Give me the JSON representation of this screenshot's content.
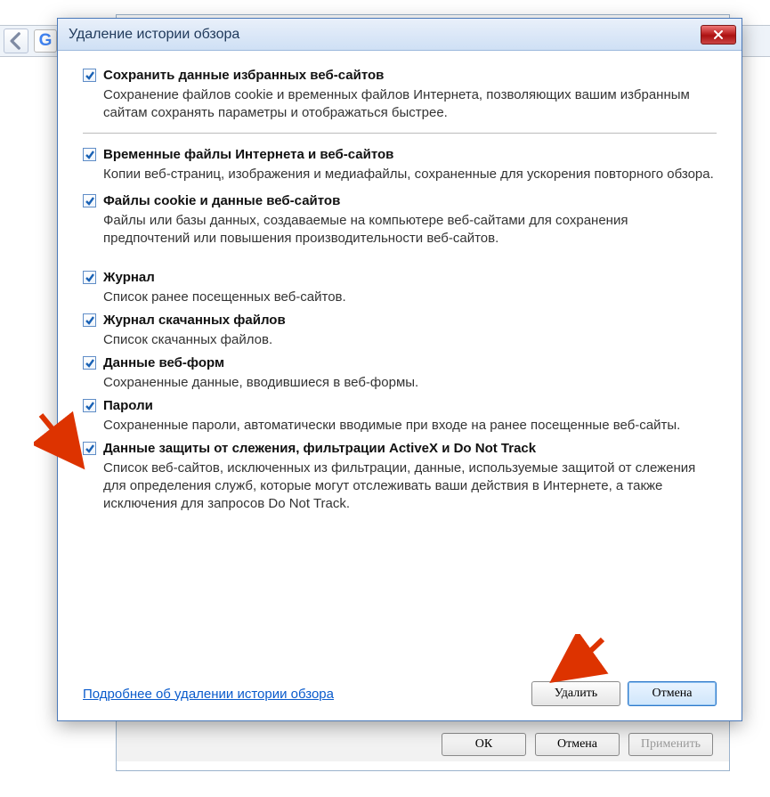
{
  "dialog": {
    "title": "Удаление истории обзора",
    "help_link": "Подробнее об удалении истории обзора",
    "delete_btn": "Удалить",
    "cancel_btn": "Отмена"
  },
  "options": [
    {
      "id": "preserve-favorites",
      "checked": true,
      "label": "Сохранить данные избранных веб-сайтов",
      "desc": "Сохранение файлов cookie и временных файлов Интернета, позволяющих вашим избранным сайтам сохранять параметры и отображаться быстрее."
    },
    {
      "id": "temp-files",
      "checked": true,
      "label": "Временные файлы Интернета и веб-сайтов",
      "desc": "Копии веб-страниц, изображения и медиафайлы, сохраненные для ускорения повторного обзора."
    },
    {
      "id": "cookies",
      "checked": true,
      "label": "Файлы cookie и данные веб-сайтов",
      "desc": "Файлы или базы данных, создаваемые на компьютере веб-сайтами для сохранения предпочтений или повышения производительности веб-сайтов."
    },
    {
      "id": "history",
      "checked": true,
      "label": "Журнал",
      "desc": "Список ранее посещенных веб-сайтов."
    },
    {
      "id": "download-history",
      "checked": true,
      "label": "Журнал скачанных файлов",
      "desc": "Список скачанных файлов."
    },
    {
      "id": "form-data",
      "checked": true,
      "label": "Данные веб-форм",
      "desc": "Сохраненные данные, вводившиеся в веб-формы."
    },
    {
      "id": "passwords",
      "checked": true,
      "label": "Пароли",
      "desc": "Сохраненные пароли, автоматически вводимые при входе на ранее посещенные веб-сайты."
    },
    {
      "id": "tracking-protection",
      "checked": true,
      "label": "Данные защиты от слежения, фильтрации ActiveX и Do Not Track",
      "desc": "Список веб-сайтов, исключенных из фильтрации, данные, используемые защитой от слежения для определения служб, которые могут отслеживать ваши действия в Интернете, а также исключения для запросов Do Not Track."
    }
  ],
  "under_buttons": {
    "ok": "ОК",
    "cancel": "Отмена",
    "apply": "Применить"
  }
}
